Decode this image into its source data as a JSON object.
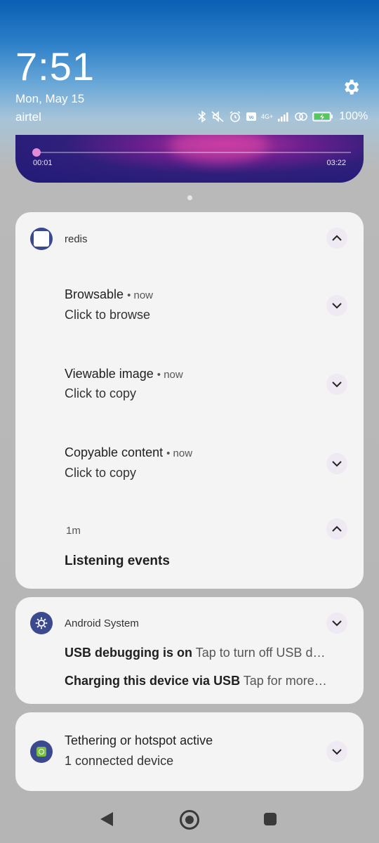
{
  "clock": {
    "time": "7:51",
    "date": "Mon, May 15",
    "carrier": "airtel"
  },
  "status": {
    "network": "4G+",
    "battery": "100%",
    "icons": [
      "bluetooth-icon",
      "mute-icon",
      "alarm-icon",
      "volte-icon",
      "signal-icon",
      "hotspot-icon",
      "battery-charging-icon"
    ]
  },
  "media": {
    "elapsed": "00:01",
    "duration": "03:22",
    "progress": 0.005
  },
  "groups": [
    {
      "app": "redis",
      "notifications": [
        {
          "title": "Browsable",
          "time": "now",
          "text": "Click to browse"
        },
        {
          "title": "Viewable image",
          "time": "now",
          "text": "Click to copy"
        },
        {
          "title": "Copyable content",
          "time": "now",
          "text": "Click to copy"
        }
      ],
      "extra": {
        "time": "1m",
        "title": "Listening events"
      }
    },
    {
      "app": "Android System",
      "lines": [
        {
          "title": "USB debugging is on",
          "text": "Tap to turn off USB d…"
        },
        {
          "title": "Charging this device via USB",
          "text": "Tap for more…"
        }
      ]
    },
    {
      "title": "Tethering or hotspot active",
      "text": "1 connected device"
    }
  ],
  "colors": {
    "accent": "#3b4a8f",
    "chip": "#efe9f3",
    "hotspot_badge": "#7bc142"
  }
}
